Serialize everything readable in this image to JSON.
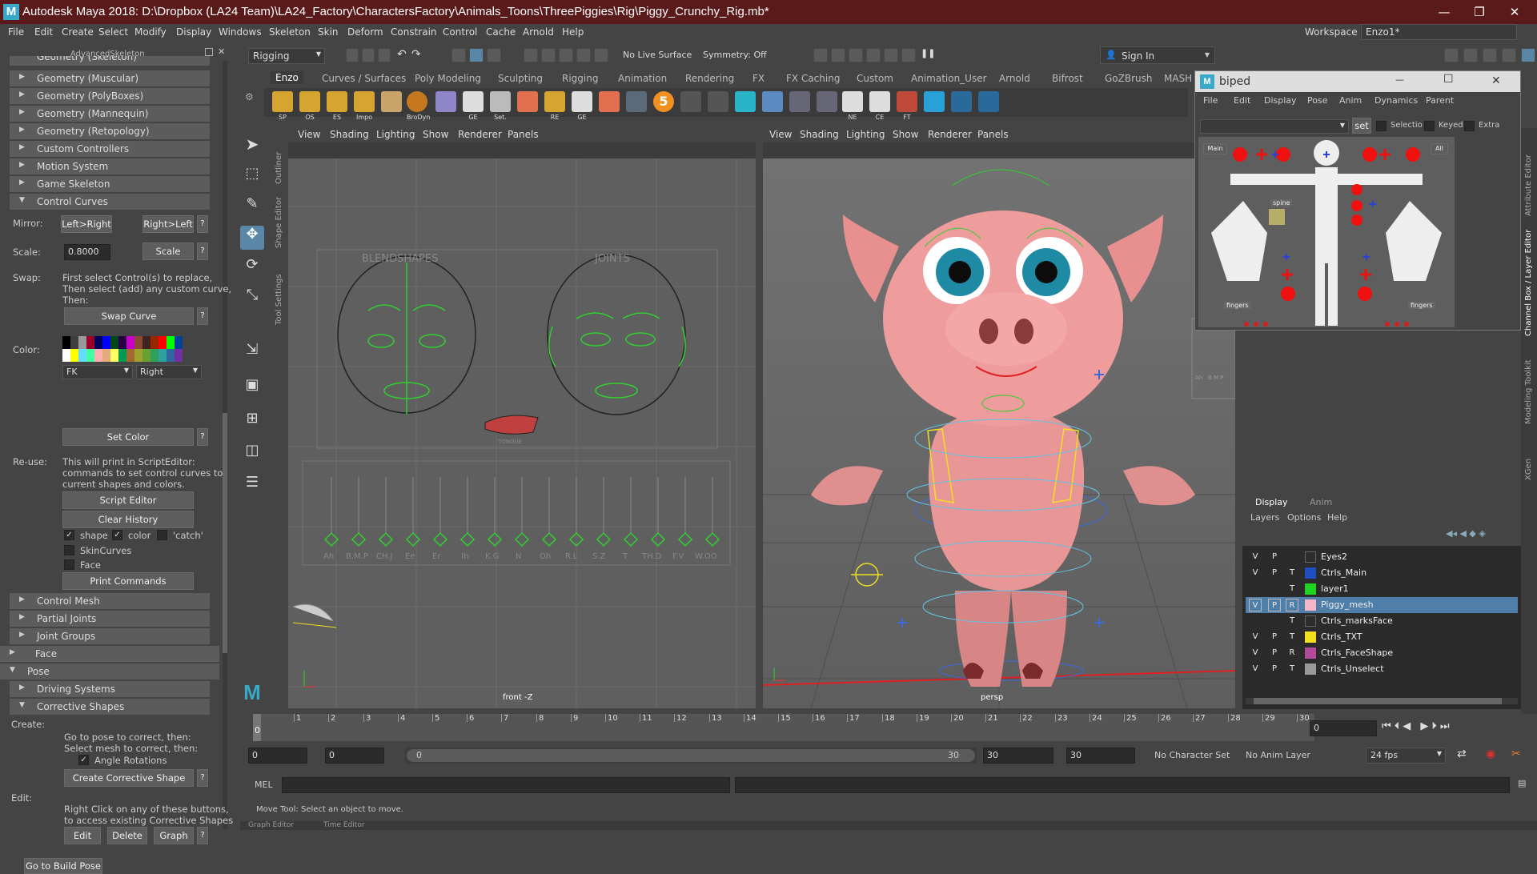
{
  "window": {
    "title": "Autodesk Maya 2018: D:\\Dropbox (LA24 Team)\\LA24_Factory\\CharactersFactory\\Animals_Toons\\ThreePiggies\\Rig\\Piggy_Crunchy_Rig.mb*",
    "logo": "M",
    "minimize": "—",
    "restore": "❐",
    "close": "✕"
  },
  "menubar": {
    "items": [
      "File",
      "Edit",
      "Create",
      "Select",
      "Modify",
      "Display",
      "Windows",
      "Skeleton",
      "Skin",
      "Deform",
      "Constrain",
      "Control",
      "Cache",
      "Arnold",
      "Help"
    ],
    "workspace_label": "Workspace :",
    "workspace_value": "Enzo1*"
  },
  "statusline": {
    "menuset": "Rigging",
    "live_surface": "No Live Surface",
    "symmetry": "Symmetry: Off",
    "sign_in": "Sign In"
  },
  "shelf": {
    "tabs": [
      "Enzo",
      "Curves / Surfaces",
      "Poly Modeling",
      "Sculpting",
      "Rigging",
      "Animation",
      "Rendering",
      "FX",
      "FX Caching",
      "Custom",
      "Animation_User",
      "Arnold",
      "Bifrost",
      "GoZBrush",
      "MASH"
    ],
    "active_tab": "Enzo",
    "buttons": [
      "SP",
      "OS",
      "ES",
      "Impo",
      "",
      "BroDyn",
      "",
      "GE",
      "Set.",
      "",
      "RE",
      "GE",
      "",
      "",
      "5",
      "",
      "",
      "",
      "",
      "",
      "",
      "",
      "NE",
      "CE",
      "FT",
      "",
      "",
      ""
    ]
  },
  "leftpanel": {
    "title": "AdvancedSkeleton",
    "cut_top": "Geometry (Skeleton)",
    "frames_top": [
      "Geometry (Muscular)",
      "Geometry (PolyBoxes)",
      "Geometry (Mannequin)",
      "Geometry (Retopology)",
      "Custom Controllers",
      "Motion System",
      "Game Skeleton"
    ],
    "control_curves": "Control Curves",
    "mirror_label": "Mirror:",
    "mirror_lr": "Left>Right",
    "mirror_rl": "Right>Left",
    "scale_label": "Scale:",
    "scale_value": "0.8000",
    "scale_btn": "Scale",
    "swap_label": "Swap:",
    "swap_help": [
      "First select Control(s) to replace,",
      "Then select (add) any custom curve,",
      "Then:"
    ],
    "swap_btn": "Swap Curve",
    "color_label": "Color:",
    "color_fk": "FK",
    "color_side": "Right",
    "set_color": "Set Color",
    "reuse_label": "Re-use:",
    "reuse_help": [
      "This will print in ScriptEditor:",
      "commands to set control curves to",
      "current shapes and colors."
    ],
    "script_editor": "Script Editor",
    "clear_history": "Clear History",
    "chk_shape": "shape",
    "chk_color": "color",
    "chk_catch": "'catch'",
    "chk_skin": "SkinCurves",
    "chk_face": "Face",
    "print_commands": "Print Commands",
    "frames_mid": [
      "Control Mesh",
      "Partial Joints",
      "Joint Groups"
    ],
    "face": "Face",
    "pose": "Pose",
    "driving": "Driving Systems",
    "corrective": "Corrective Shapes",
    "create_label": "Create:",
    "create_help": [
      "Go to pose to correct, then:",
      "Select mesh to correct, then:"
    ],
    "angle_rotations": "Angle Rotations",
    "create_btn": "Create Corrective Shape",
    "edit_label": "Edit:",
    "edit_help": [
      "Right Click on any of these buttons,",
      "to access existing Corrective Shapes"
    ],
    "edit_btn": "Edit",
    "delete_btn": "Delete",
    "graph_btn": "Graph",
    "build_pose": "Go to Build Pose",
    "q": "?",
    "check": "✓"
  },
  "vertical_tabs": {
    "outliner": "Outliner",
    "shape_editor": "Shape Editor",
    "tool_settings": "Tool Settings",
    "attribute_editor": "Attribute Editor",
    "channel_box": "Channel Box / Layer Editor",
    "modeling_toolkit": "Modeling Toolkit",
    "xgen": "XGen"
  },
  "viewport_menu": [
    "View",
    "Shading",
    "Lighting",
    "Show",
    "Renderer",
    "Panels"
  ],
  "front_viewport": {
    "camera": "front -Z",
    "blendshapes": "BLENDSHAPES",
    "joints": "JOINTS",
    "tongue": "TONGUE",
    "sliders": [
      "Ah",
      "B.M.P",
      "CH.J",
      "Ee",
      "Er",
      "Ih",
      "K.G",
      "N",
      "Oh",
      "R.L",
      "S.Z",
      "T",
      "TH.D",
      "F.V",
      "W.OO"
    ]
  },
  "persp_viewport": {
    "camera": "persp",
    "mini_labels": [
      "Ah",
      "B.M.P"
    ]
  },
  "biped": {
    "title": "biped",
    "menu": [
      "File",
      "Edit",
      "Display",
      "Pose",
      "Anim",
      "Dynamics",
      "Parent"
    ],
    "set_btn": "set",
    "selection": "Selection",
    "keyed": "Keyed",
    "extra": "Extra",
    "main": "Main",
    "all": "All",
    "spine": "spine",
    "fingers_l": "fingers",
    "fingers_r": "fingers",
    "logo": "M",
    "minimize": "—",
    "maximize": "☐",
    "close": "✕"
  },
  "layer_editor": {
    "tabs": [
      "Display",
      "Anim"
    ],
    "menu": [
      "Layers",
      "Options",
      "Help"
    ],
    "layers": [
      {
        "v": "V",
        "p": "P",
        "t": "",
        "name": "Eyes2",
        "color": "",
        "selected": false
      },
      {
        "v": "V",
        "p": "P",
        "t": "T",
        "name": "Ctrls_Main",
        "color": "#1f4fbf",
        "selected": false
      },
      {
        "v": "",
        "p": "",
        "t": "T",
        "name": "layer1",
        "color": "#22d422",
        "selected": false
      },
      {
        "v": "V",
        "p": "P",
        "t": "R",
        "name": "Piggy_mesh",
        "color": "#f4b6c8",
        "selected": true
      },
      {
        "v": "",
        "p": "",
        "t": "T",
        "name": "Ctrls_marksFace",
        "color": "",
        "selected": false
      },
      {
        "v": "V",
        "p": "P",
        "t": "T",
        "name": "Ctrls_TXT",
        "color": "#f0e020",
        "selected": false
      },
      {
        "v": "V",
        "p": "P",
        "t": "R",
        "name": "Ctrls_FaceShape",
        "color": "#b44a9a",
        "selected": false
      },
      {
        "v": "V",
        "p": "P",
        "t": "T",
        "name": "Ctrls_Unselect",
        "color": "#9a9a9a",
        "selected": false
      }
    ]
  },
  "timeslider": {
    "ticks": [
      "0",
      "1",
      "2",
      "3",
      "4",
      "5",
      "6",
      "7",
      "8",
      "9",
      "10",
      "11",
      "12",
      "13",
      "14",
      "15",
      "16",
      "17",
      "18",
      "19",
      "20",
      "21",
      "22",
      "23",
      "24",
      "25",
      "26",
      "27",
      "28",
      "29",
      "30"
    ],
    "current": "0",
    "current_field": "0"
  },
  "rangeslider": {
    "start": "0",
    "anim_start": "0",
    "range_inner_start": "0",
    "range_inner_end": "30",
    "range_end": "30",
    "anim_end": "30",
    "char_set": "No Character Set",
    "anim_layer": "No Anim Layer",
    "fps": "24 fps"
  },
  "cmdline": {
    "label": "MEL"
  },
  "helpline": {
    "text": "Move Tool: Select an object to move."
  },
  "bottomtabs": [
    "Graph Editor",
    "Time Editor"
  ]
}
